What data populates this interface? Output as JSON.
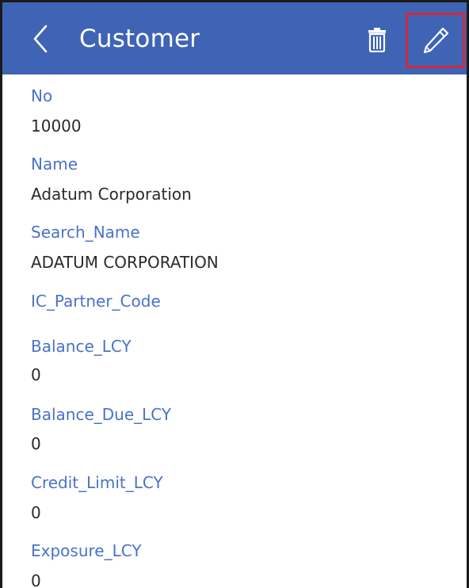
{
  "header": {
    "title": "Customer",
    "back_icon": "chevron-left-icon",
    "delete_icon": "trash-icon",
    "edit_icon": "pencil-icon"
  },
  "colors": {
    "header_bg": "#3f64b5",
    "label": "#4a72c8",
    "value": "#2a2a2a",
    "highlight": "#d12a3a"
  },
  "fields": [
    {
      "label": "No",
      "value": "10000"
    },
    {
      "label": "Name",
      "value": "Adatum Corporation"
    },
    {
      "label": "Search_Name",
      "value": "ADATUM CORPORATION"
    },
    {
      "label": "IC_Partner_Code",
      "value": ""
    },
    {
      "label": "Balance_LCY",
      "value": "0"
    },
    {
      "label": "Balance_Due_LCY",
      "value": "0"
    },
    {
      "label": "Credit_Limit_LCY",
      "value": "0"
    },
    {
      "label": "Exposure_LCY",
      "value": "0"
    }
  ]
}
